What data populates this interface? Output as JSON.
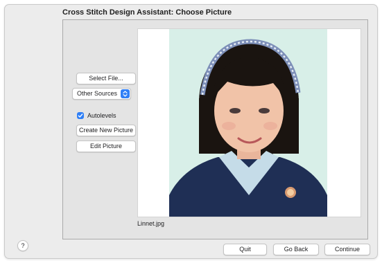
{
  "window": {
    "title": "Cross Stitch Design Assistant: Choose Picture"
  },
  "left_controls": {
    "select_file_label": "Select File...",
    "other_sources_label": "Other Sources",
    "autolevels_label": "Autolevels",
    "autolevels_checked": true,
    "create_new_picture_label": "Create New Picture",
    "edit_picture_label": "Edit Picture"
  },
  "picture": {
    "filename": "Linnet.jpg"
  },
  "footer": {
    "help_label": "?",
    "quit_label": "Quit",
    "go_back_label": "Go Back",
    "continue_label": "Continue"
  },
  "colors": {
    "accent": "#2f7ff6",
    "window_bg": "#ececec",
    "photo_bg": "#d8efe8"
  },
  "icons": {
    "popup_arrows": "chevron-up-down-icon",
    "checkbox": "checkmark-icon"
  }
}
